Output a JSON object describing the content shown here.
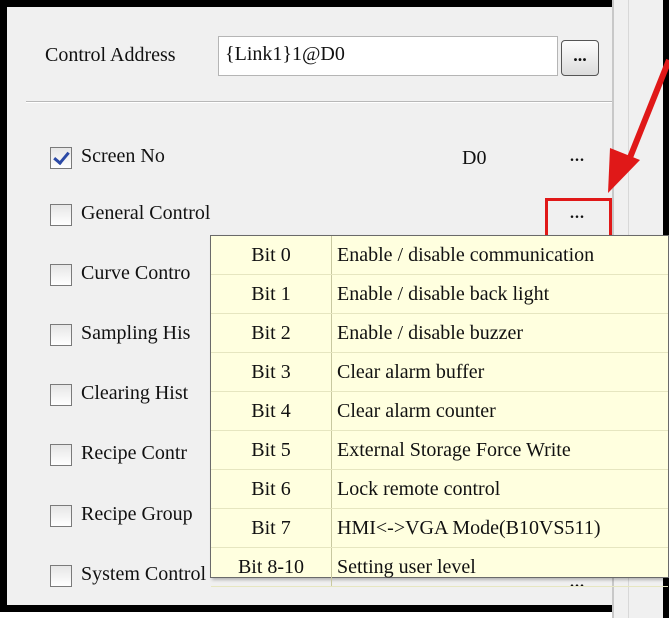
{
  "control_address": {
    "label": "Control Address",
    "value": "{Link1}1@D0",
    "browse_label": "..."
  },
  "rows": [
    {
      "label": "Screen No",
      "checked": true,
      "value": "D0",
      "dots": "..."
    },
    {
      "label": "General Control",
      "checked": false,
      "dots": "..."
    },
    {
      "label": "Curve Contro",
      "checked": false
    },
    {
      "label": "Sampling His",
      "checked": false
    },
    {
      "label": "Clearing Hist",
      "checked": false
    },
    {
      "label": "Recipe Contr",
      "checked": false
    },
    {
      "label": "Recipe Group",
      "checked": false
    },
    {
      "label": "System Control",
      "checked": false,
      "dots": "..."
    }
  ],
  "popup": {
    "items": [
      {
        "bit": "Bit 0",
        "desc": "Enable / disable communication"
      },
      {
        "bit": "Bit 1",
        "desc": "Enable / disable back light"
      },
      {
        "bit": "Bit 2",
        "desc": "Enable / disable buzzer"
      },
      {
        "bit": "Bit 3",
        "desc": "Clear alarm buffer"
      },
      {
        "bit": "Bit 4",
        "desc": "Clear alarm counter"
      },
      {
        "bit": "Bit 5",
        "desc": "External Storage Force Write"
      },
      {
        "bit": "Bit 6",
        "desc": " Lock remote control"
      },
      {
        "bit": "Bit 7",
        "desc": "HMI<->VGA Mode(B10VS511)"
      },
      {
        "bit": "Bit 8-10",
        "desc": "Setting user level"
      }
    ]
  },
  "colors": {
    "highlight": "#e01818",
    "popup_bg": "#ffffdf",
    "panel_bg": "#f0f0f0"
  }
}
